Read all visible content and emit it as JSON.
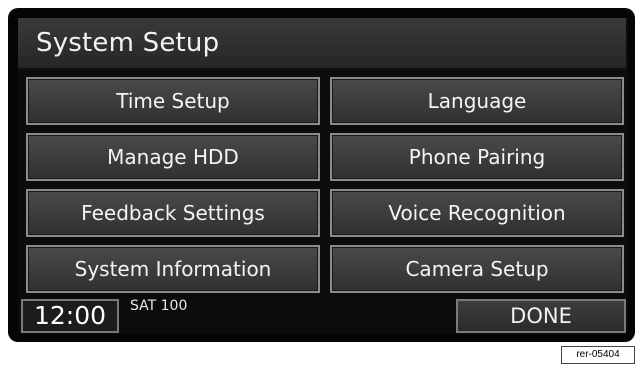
{
  "header": {
    "title": "System Setup"
  },
  "menu": {
    "items": [
      {
        "label": "Time Setup"
      },
      {
        "label": "Language"
      },
      {
        "label": "Manage HDD"
      },
      {
        "label": "Phone Pairing"
      },
      {
        "label": "Feedback Settings"
      },
      {
        "label": "Voice Recognition"
      },
      {
        "label": "System Information"
      },
      {
        "label": "Camera Setup"
      }
    ]
  },
  "status": {
    "clock": "12:00",
    "radio_info": "SAT 100",
    "done_label": "DONE"
  },
  "reference": {
    "code": "rer-05404"
  },
  "colors": {
    "screen_background": "#0c0c0c",
    "button_border": "#8b8b8b",
    "text": "#f4f4f4"
  }
}
